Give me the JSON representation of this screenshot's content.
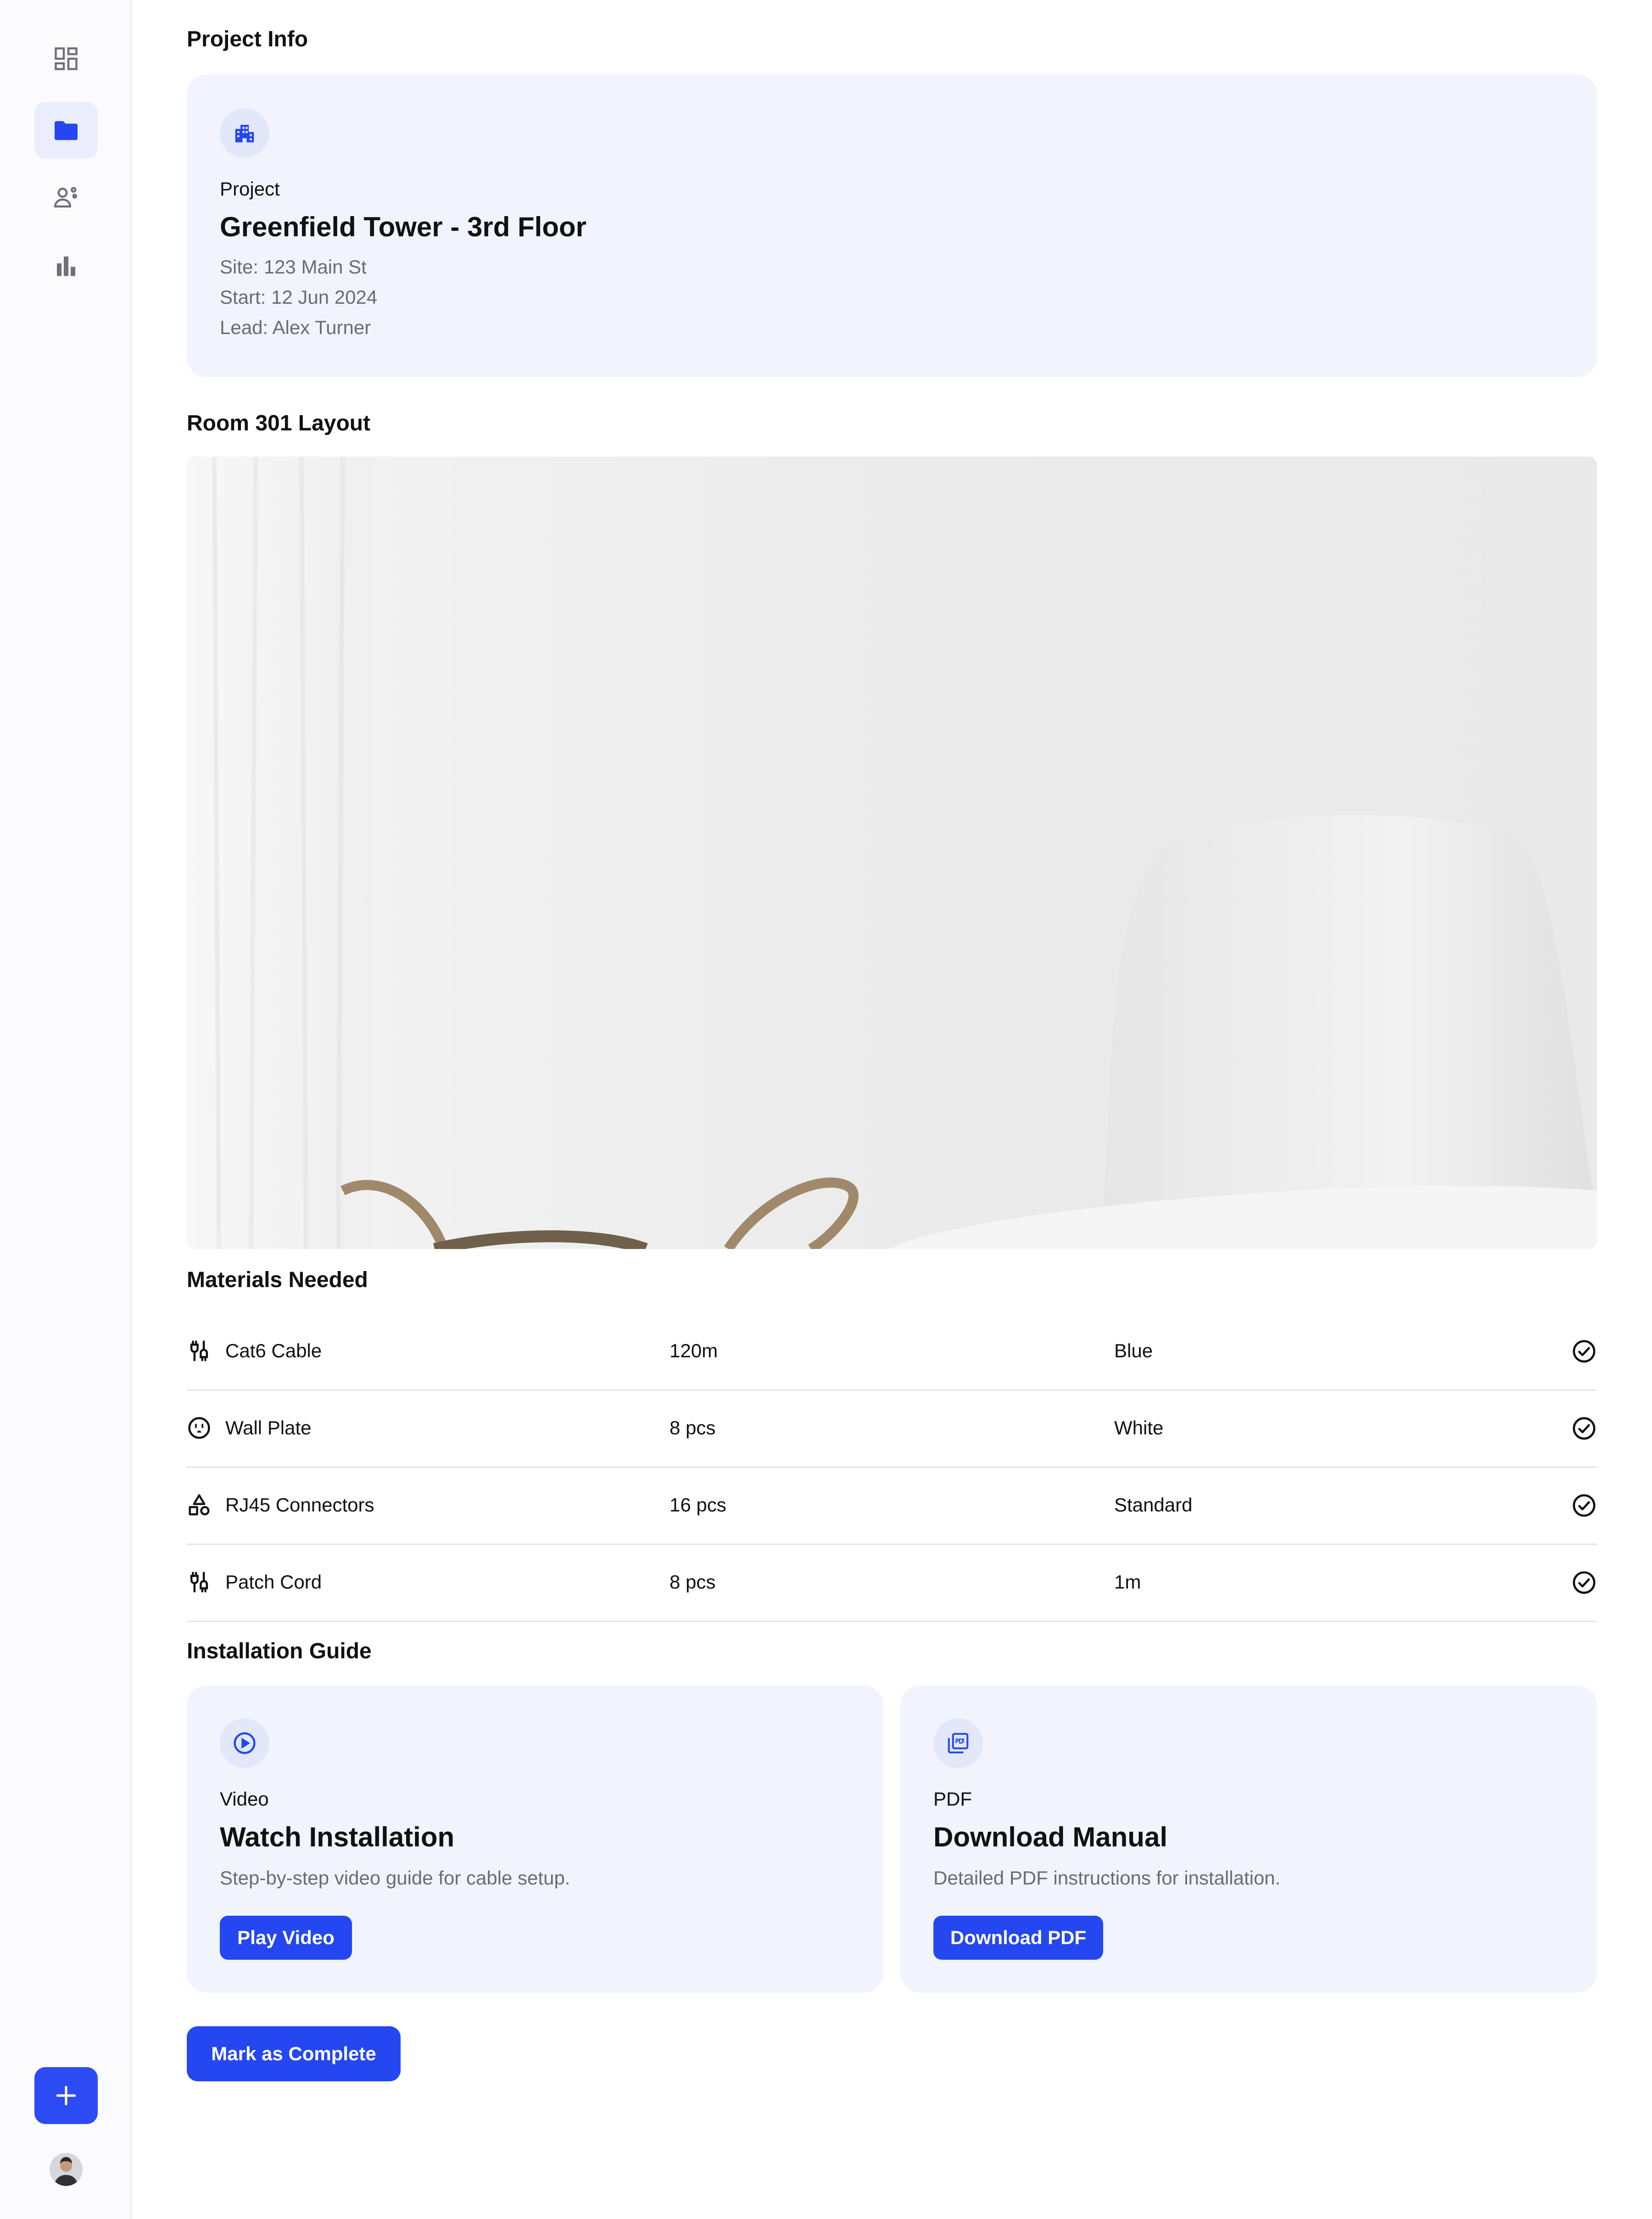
{
  "sidebar": {
    "items": [
      {
        "name": "dashboard",
        "icon": "dashboard-icon"
      },
      {
        "name": "projects",
        "icon": "folder-icon",
        "active": true
      },
      {
        "name": "team",
        "icon": "team-icon"
      },
      {
        "name": "reports",
        "icon": "bar-chart-icon"
      }
    ],
    "fab_icon": "plus-icon"
  },
  "project_info": {
    "section_title": "Project Info",
    "kicker": "Project",
    "title": "Greenfield Tower - 3rd Floor",
    "site": "Site: 123 Main St",
    "start": "Start: 12 Jun 2024",
    "lead": "Lead: Alex Turner",
    "icon": "building-icon"
  },
  "layout": {
    "section_title": "Room 301 Layout"
  },
  "materials": {
    "section_title": "Materials Needed",
    "rows": [
      {
        "name": "Cat6 Cable",
        "qty": "120m",
        "spec": "Blue",
        "icon": "cable-icon"
      },
      {
        "name": "Wall Plate",
        "qty": "8 pcs",
        "spec": "White",
        "icon": "outlet-icon"
      },
      {
        "name": "RJ45 Connectors",
        "qty": "16 pcs",
        "spec": "Standard",
        "icon": "shapes-icon"
      },
      {
        "name": "Patch Cord",
        "qty": "8 pcs",
        "spec": "1m",
        "icon": "cable-icon"
      }
    ]
  },
  "guide": {
    "section_title": "Installation Guide",
    "video": {
      "kicker": "Video",
      "title": "Watch Installation",
      "desc": "Step-by-step video guide for cable setup.",
      "button": "Play Video"
    },
    "pdf": {
      "kicker": "PDF",
      "title": "Download Manual",
      "desc": "Detailed PDF instructions for installation.",
      "button": "Download PDF"
    }
  },
  "actions": {
    "complete": "Mark as Complete"
  },
  "colors": {
    "accent": "#2447f2",
    "card_bg": "#f1f4fd",
    "muted_text": "#6b6b72"
  }
}
